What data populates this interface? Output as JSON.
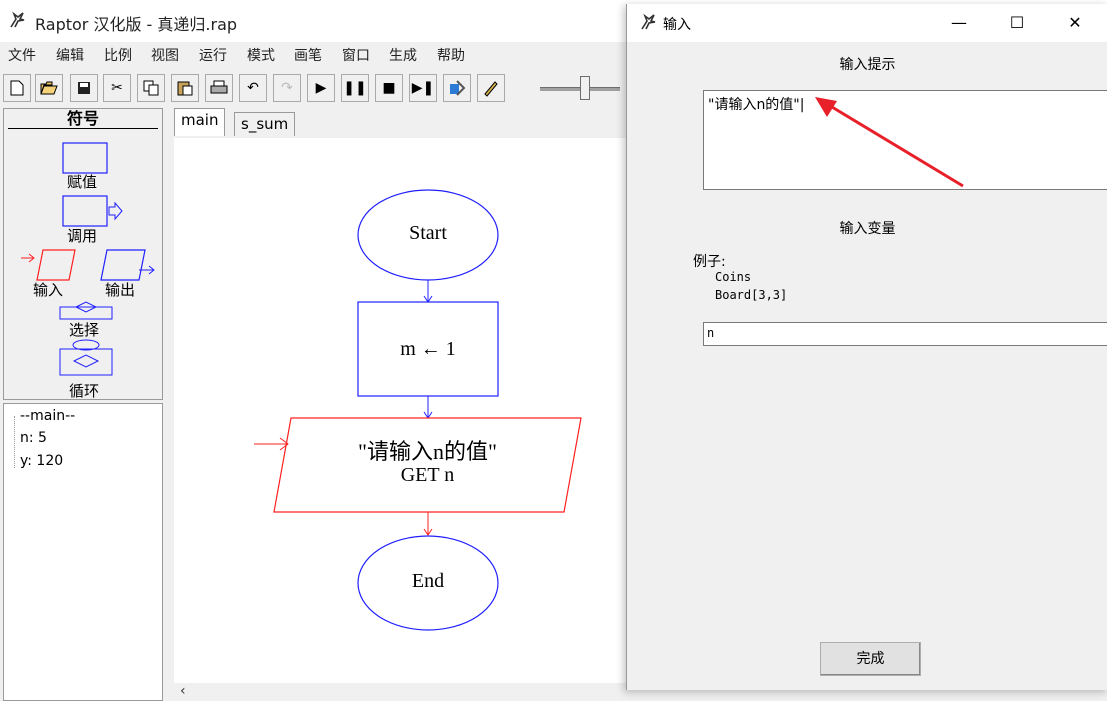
{
  "app": {
    "title": "Raptor 汉化版 - 真递归.rap",
    "icon": "raptor-icon"
  },
  "menu": [
    "文件",
    "编辑",
    "比例",
    "视图",
    "运行",
    "模式",
    "画笔",
    "窗口",
    "生成",
    "帮助"
  ],
  "toolbar": {
    "icons": [
      "new-icon",
      "open-icon",
      "save-icon",
      "cut-icon",
      "copy-icon",
      "paste-icon",
      "print-icon",
      "undo-icon",
      "redo-icon",
      "play-icon",
      "pause-icon",
      "stop-icon",
      "step-icon",
      "generate-icon",
      "pen-icon"
    ]
  },
  "symbols": {
    "header": "符号",
    "assignment": "赋值",
    "call": "调用",
    "input": "输入",
    "output": "输出",
    "selection": "选择",
    "loop": "循环"
  },
  "watch": {
    "items": [
      "--main--",
      "n: 5",
      "y: 120"
    ]
  },
  "tabs": [
    "main",
    "s_sum"
  ],
  "flowchart": {
    "start": "Start",
    "assign": "m ← 1",
    "input_prompt": "\"请输入n的值\"",
    "input_get": "GET n",
    "end": "End"
  },
  "dialog": {
    "title": "输入",
    "prompt_label": "输入提示",
    "prompt_value": "\"请输入n的值\"|",
    "var_label": "输入变量",
    "example_label": "例子:",
    "example_lines": [
      "Coins",
      "Board[3,3]"
    ],
    "var_value": "n",
    "done_label": "完成"
  },
  "colors": {
    "flow_blue": "#2020ff",
    "input_red": "#ff2020",
    "arrow_red": "#e8202a"
  }
}
